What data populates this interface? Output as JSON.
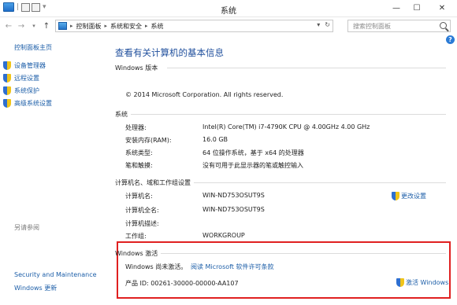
{
  "window": {
    "title": "系统",
    "minimize": "—",
    "maximize": "☐",
    "close": "✕"
  },
  "address": {
    "breadcrumbs": [
      "控制面板",
      "系统和安全",
      "系统"
    ],
    "search_placeholder": "搜索控制面板"
  },
  "sidebar": {
    "home": "控制面板主页",
    "items": [
      {
        "label": "设备管理器"
      },
      {
        "label": "远程设置"
      },
      {
        "label": "系统保护"
      },
      {
        "label": "高级系统设置"
      }
    ],
    "see_also_title": "另请参阅",
    "see_also": [
      "Security and Maintenance",
      "Windows 更新"
    ]
  },
  "main": {
    "title": "查看有关计算机的基本信息",
    "edition_section": "Windows 版本",
    "copyright": "© 2014 Microsoft Corporation. All rights reserved.",
    "system_section": "系统",
    "system_rows": [
      {
        "label": "处理器:",
        "value": "Intel(R) Core(TM) i7-4790K CPU @ 4.00GHz   4.00 GHz"
      },
      {
        "label": "安装内存(RAM):",
        "value": "16.0 GB"
      },
      {
        "label": "系统类型:",
        "value": "64 位操作系统，基于 x64 的处理器"
      },
      {
        "label": "笔和触摸:",
        "value": "没有可用于此显示器的笔或触控输入"
      }
    ],
    "computer_section": "计算机名、域和工作组设置",
    "computer_rows": [
      {
        "label": "计算机名:",
        "value": "WIN-ND753OSUT9S"
      },
      {
        "label": "计算机全名:",
        "value": "WIN-ND753OSUT9S"
      },
      {
        "label": "计算机描述:",
        "value": ""
      },
      {
        "label": "工作组:",
        "value": "WORKGROUP"
      }
    ],
    "change_settings": "更改设置",
    "activation_section": "Windows 激活",
    "activation_status": "Windows 尚未激活。",
    "license_link": "阅读 Microsoft 软件许可条款",
    "product_id": "产品 ID: 00261-30000-00000-AA107",
    "activate_windows": "激活 Windows"
  },
  "colors": {
    "link": "#1c5ea8",
    "title": "#1e4e9c",
    "highlight_border": "#e02020"
  }
}
